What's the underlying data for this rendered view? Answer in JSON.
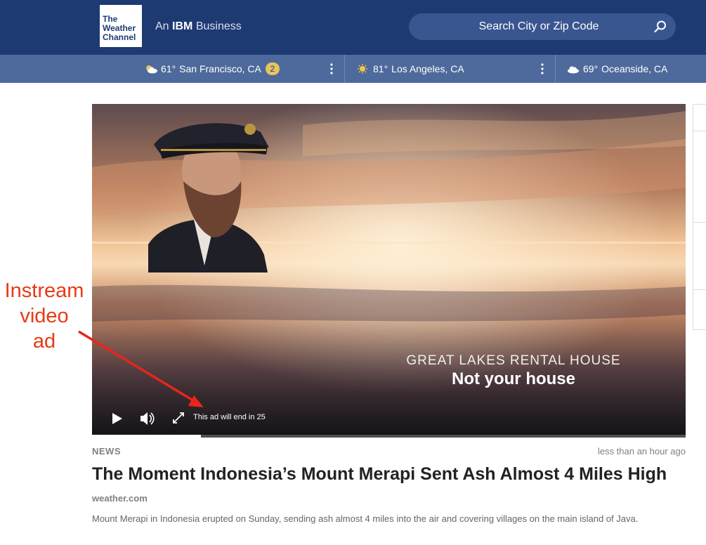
{
  "header": {
    "logo_lines": [
      "The",
      "Weather",
      "Channel"
    ],
    "tagline_prefix": "An",
    "tagline_brand": "IBM",
    "tagline_suffix": "Business",
    "search_placeholder": "Search City or Zip Code",
    "background_color": "#1e3a73"
  },
  "locations": [
    {
      "temp": "61°",
      "name": "San Francisco, CA",
      "badge": "2",
      "icon": "partly-cloudy-icon"
    },
    {
      "temp": "81°",
      "name": "Los Angeles, CA",
      "icon": "sun-icon"
    },
    {
      "temp": "69°",
      "name": "Oceanside, CA",
      "icon": "cloud-icon"
    }
  ],
  "video": {
    "ad_line1": "GREAT LAKES RENTAL HOUSE",
    "ad_line2": "Not your house",
    "ad_timer": "This ad will end in 25",
    "controls": [
      "play-icon",
      "volume-icon",
      "fullscreen-icon"
    ]
  },
  "annotation": {
    "lines": [
      "Instream",
      "video",
      "ad"
    ],
    "color": "#e63b17"
  },
  "article": {
    "category": "NEWS",
    "time": "less than an hour ago",
    "headline": "The Moment Indonesia’s Mount Merapi Sent Ash Almost 4 Miles High",
    "source": "weather.com",
    "summary": "Mount Merapi in Indonesia erupted on Sunday, sending ash almost 4 miles into the air and covering villages on the main island of Java."
  }
}
